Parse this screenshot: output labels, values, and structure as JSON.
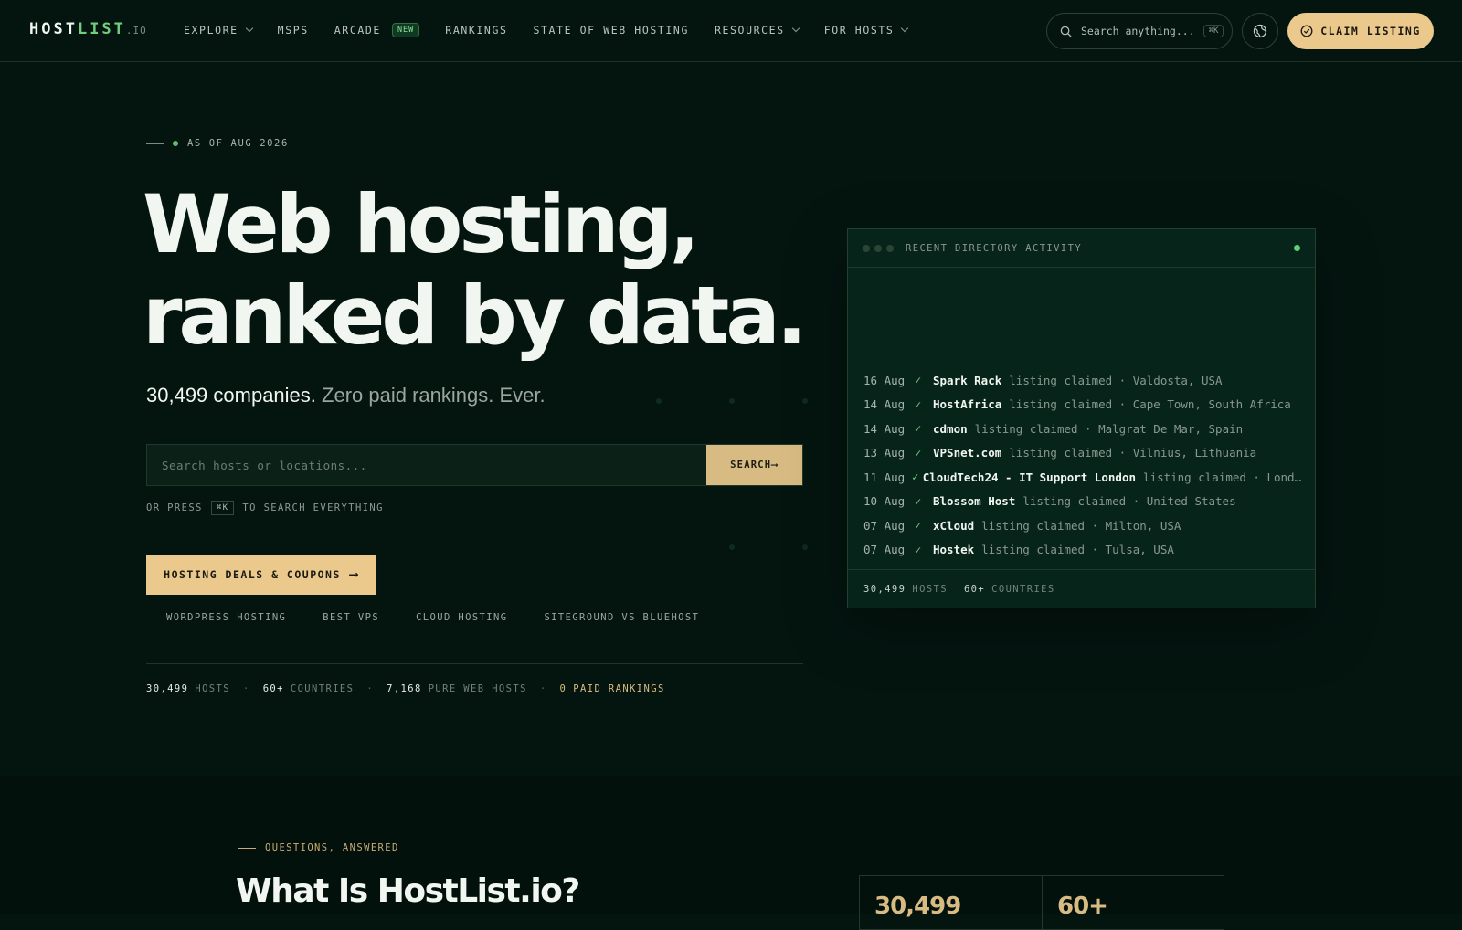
{
  "nav": {
    "logo": {
      "host": "HOST",
      "list": "LIST",
      "tld": ".IO"
    },
    "items": [
      {
        "label": "EXPLORE",
        "dropdown": true
      },
      {
        "label": "MSPS",
        "dropdown": false
      },
      {
        "label": "ARCADE",
        "dropdown": false,
        "badge": "NEW"
      },
      {
        "label": "RANKINGS",
        "dropdown": false
      },
      {
        "label": "STATE OF WEB HOSTING",
        "dropdown": false
      },
      {
        "label": "RESOURCES",
        "dropdown": true
      },
      {
        "label": "FOR HOSTS",
        "dropdown": true
      }
    ],
    "search_label": "Search anything...",
    "search_shortcut": "⌘K",
    "claim_label": "CLAIM LISTING"
  },
  "hero": {
    "eyebrow": "AS OF AUG 2026",
    "headline_line1": "Web hosting,",
    "headline_line2": "ranked by data.",
    "sub_strong": "30,499 companies.",
    "sub_rest": "Zero paid rankings. Ever.",
    "search_placeholder": "Search hosts or locations...",
    "search_button": "SEARCH",
    "hint_prefix": "OR PRESS",
    "hint_key": "⌘K",
    "hint_suffix": "TO SEARCH EVERYTHING",
    "deals_button": "HOSTING DEALS & COUPONS",
    "quick_links": [
      "WORDPRESS HOSTING",
      "BEST VPS",
      "CLOUD HOSTING",
      "SITEGROUND VS BLUEHOST"
    ],
    "stats": [
      {
        "num": "30,499",
        "label": "HOSTS"
      },
      {
        "num": "60+",
        "label": "COUNTRIES"
      },
      {
        "num": "7,168",
        "label": "PURE WEB HOSTS"
      },
      {
        "num": "0",
        "label": "PAID RANKINGS"
      }
    ]
  },
  "activity": {
    "title": "RECENT DIRECTORY ACTIVITY",
    "rows": [
      {
        "date": "16 Aug",
        "name": "Spark Rack",
        "rest": "listing claimed · Valdosta, USA"
      },
      {
        "date": "14 Aug",
        "name": "HostAfrica",
        "rest": "listing claimed · Cape Town, South Africa"
      },
      {
        "date": "14 Aug",
        "name": "cdmon",
        "rest": "listing claimed · Malgrat De Mar, Spain"
      },
      {
        "date": "13 Aug",
        "name": "VPSnet.com",
        "rest": "listing claimed · Vilnius, Lithuania"
      },
      {
        "date": "11 Aug",
        "name": "CloudTech24 - IT Support London",
        "rest": "listing claimed · London, United Kingdom"
      },
      {
        "date": "10 Aug",
        "name": "Blossom Host",
        "rest": "listing claimed · United States"
      },
      {
        "date": "07 Aug",
        "name": "xCloud",
        "rest": "listing claimed · Milton, USA"
      },
      {
        "date": "07 Aug",
        "name": "Hostek",
        "rest": "listing claimed · Tulsa, USA"
      }
    ],
    "footer": [
      {
        "num": "30,499",
        "label": "HOSTS"
      },
      {
        "num": "60+",
        "label": "COUNTRIES"
      }
    ]
  },
  "faq": {
    "eyebrow": "QUESTIONS, ANSWERED",
    "title": "What Is HostList.io?",
    "stat1": "30,499",
    "stat2": "60+"
  },
  "colors": {
    "background": "#041510",
    "accent_gold": "#ebc98d",
    "accent_green": "#6fcf7f"
  }
}
